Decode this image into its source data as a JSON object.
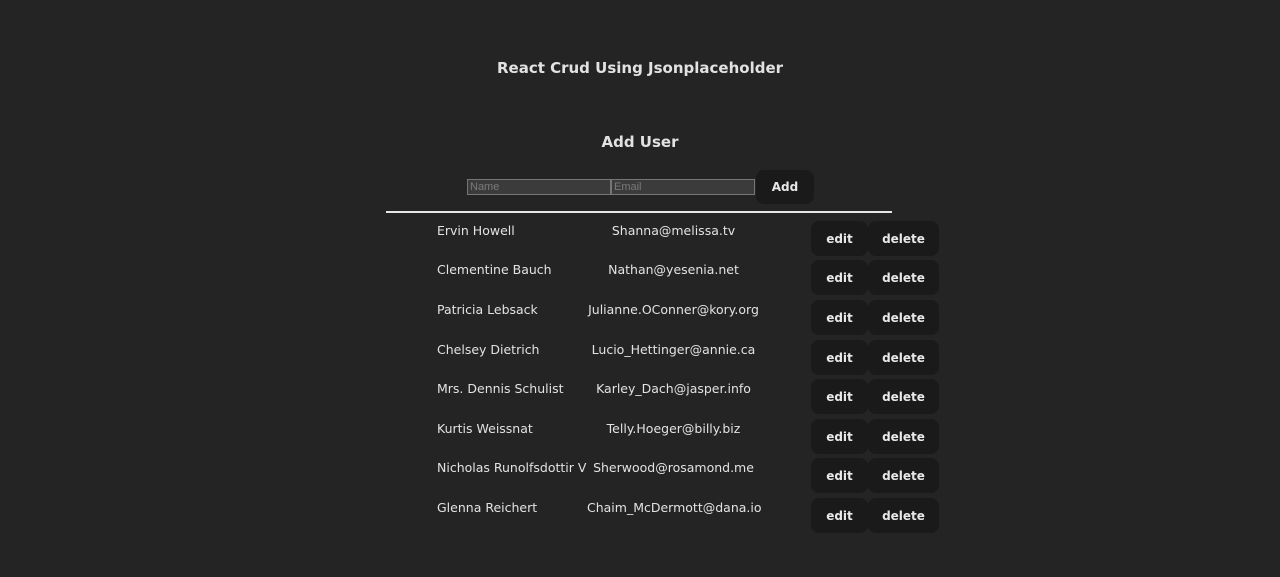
{
  "header": {
    "title": "React Crud Using Jsonplaceholder"
  },
  "add_form": {
    "heading": "Add User",
    "name_placeholder": "Name",
    "email_placeholder": "Email",
    "add_label": "Add"
  },
  "actions": {
    "edit_label": "edit",
    "delete_label": "delete"
  },
  "users": [
    {
      "name": "Ervin Howell",
      "email": "Shanna@melissa.tv"
    },
    {
      "name": "Clementine Bauch",
      "email": "Nathan@yesenia.net"
    },
    {
      "name": "Patricia Lebsack",
      "email": "Julianne.OConner@kory.org"
    },
    {
      "name": "Chelsey Dietrich",
      "email": "Lucio_Hettinger@annie.ca"
    },
    {
      "name": "Mrs. Dennis Schulist",
      "email": "Karley_Dach@jasper.info"
    },
    {
      "name": "Kurtis Weissnat",
      "email": "Telly.Hoeger@billy.biz"
    },
    {
      "name": "Nicholas Runolfsdottir V",
      "email": "Sherwood@rosamond.me"
    },
    {
      "name": "Glenna Reichert",
      "email": "Chaim_McDermott@dana.io"
    }
  ]
}
